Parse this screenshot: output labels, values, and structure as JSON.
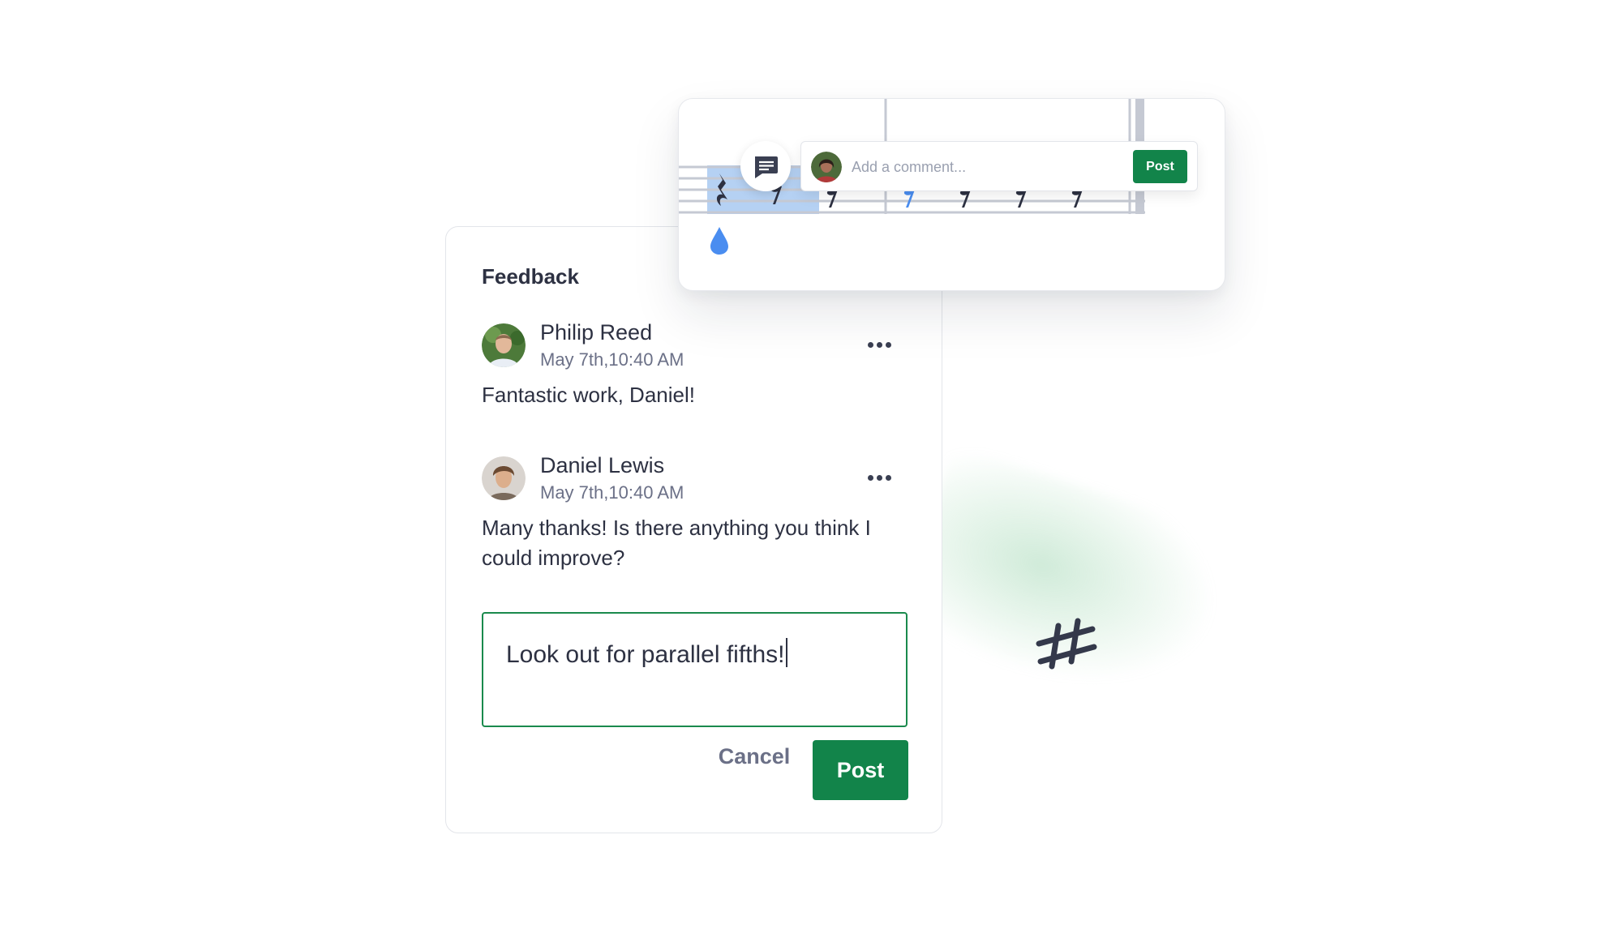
{
  "feedback": {
    "title": "Feedback",
    "comments": [
      {
        "author": "Philip Reed",
        "timestamp": "May 7th,10:40 AM",
        "text": "Fantastic work, Daniel!"
      },
      {
        "author": "Daniel Lewis",
        "timestamp": "May 7th,10:40 AM",
        "text": "Many thanks! Is there anything you think I could improve?"
      }
    ],
    "reply": {
      "value": "Look out for parallel fifths!"
    },
    "cancel_label": "Cancel",
    "post_label": "Post"
  },
  "score_card": {
    "comment_placeholder": "Add a comment...",
    "post_label": "Post",
    "icons": [
      "comment-icon",
      "dynamic-marker-icon",
      "quarter-rest-icon",
      "eighth-rest-icon"
    ]
  },
  "decor": {
    "icon": "sharp-icon"
  },
  "colors": {
    "accent": "#12844a",
    "selection": "#b5d1f3",
    "marker": "#4a8df0"
  }
}
